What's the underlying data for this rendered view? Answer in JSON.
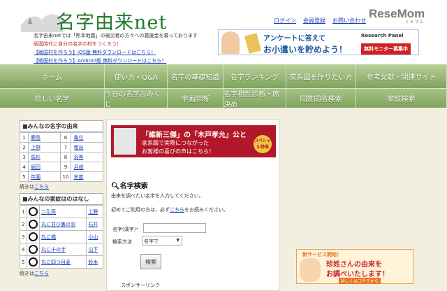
{
  "header": {
    "logo": "名字由来net",
    "top_links": [
      "ログイン",
      "会員登録",
      "お問い合わせ"
    ],
    "corner_logo": "ReseMom",
    "corner_logo_sub": "リセマム",
    "notices": [
      "名字由来netでは「熊本地震」の被災者の方々への義援金を募っております",
      "戦国時代に自分の名字の村をつくろう！",
      "【戦国村を作ろう】iOS版 無料ダウンロードはこちら！",
      "【戦国村を作ろう】Android版 無料ダウンロードはこちら！"
    ],
    "banner": {
      "line1": "アンケートに答えて",
      "line2": "お小遣いを貯めよう！",
      "brand": "Research Panel",
      "cta": "無料モニター募集中"
    }
  },
  "nav": {
    "row1": [
      "ホーム",
      "使い方・Q&A",
      "名字の基礎知識",
      "名字ランキング",
      "家系図を作りたい方",
      "参考文献・関連サイト"
    ],
    "row2": [
      "珍しい名字",
      "今日の名字おみくじ",
      "字画診断",
      "名字相性診断・席決め",
      "同姓同名検索",
      "家紋検索"
    ]
  },
  "sidebar": {
    "names_title": "■みんなの名字の由来",
    "names": [
      {
        "n1": "1",
        "a": "鹿島",
        "n2": "6",
        "b": "亀位"
      },
      {
        "n1": "2",
        "a": "上野",
        "n2": "7",
        "b": "粗出"
      },
      {
        "n1": "3",
        "a": "馬杉",
        "n2": "8",
        "b": "羽黒"
      },
      {
        "n1": "4",
        "a": "堀田",
        "n2": "9",
        "b": "月岐"
      },
      {
        "n1": "5",
        "a": "年園",
        "n2": "10",
        "b": "末度"
      }
    ],
    "more_prefix": "続きは",
    "more_link": "こちら",
    "crests_title": "■みんなの家紋はのはなし",
    "crests": [
      {
        "no": "1",
        "name": "二引両",
        "owner": "上野"
      },
      {
        "no": "2",
        "name": "丸に並び鷹の羽",
        "owner": "石井"
      },
      {
        "no": "3",
        "name": "丸に橘",
        "owner": "小山"
      },
      {
        "no": "4",
        "name": "丸に十の字",
        "owner": "山下"
      },
      {
        "no": "5",
        "name": "丸に四つ目菱",
        "owner": "鈴木"
      }
    ]
  },
  "main": {
    "ad": {
      "line1": "「維新三傑」の「木戸孝允」公と",
      "line2": "家系図で実際につながった",
      "line3": "お客様の喜びの声はこちら！",
      "badge": "スペシャル特典"
    },
    "search_title": "名字検索",
    "intro": "由来を調べたい名字を入力してください。",
    "first_prefix": "初めてご利用の方は、必ず",
    "first_link": "こちら",
    "first_suffix": "をお読みください。",
    "label_name": "名字(漢字)",
    "required_mark": "*",
    "label_method": "検索方法",
    "method_value": "名字で",
    "submit": "検索",
    "sponsored": "スポンサーリンク"
  },
  "right_ad": {
    "tagline": "新サービス開始！",
    "line1": "珍姓さんの由来を",
    "line2": "お調べいたします！",
    "cta": "詳しくはコチラから"
  }
}
